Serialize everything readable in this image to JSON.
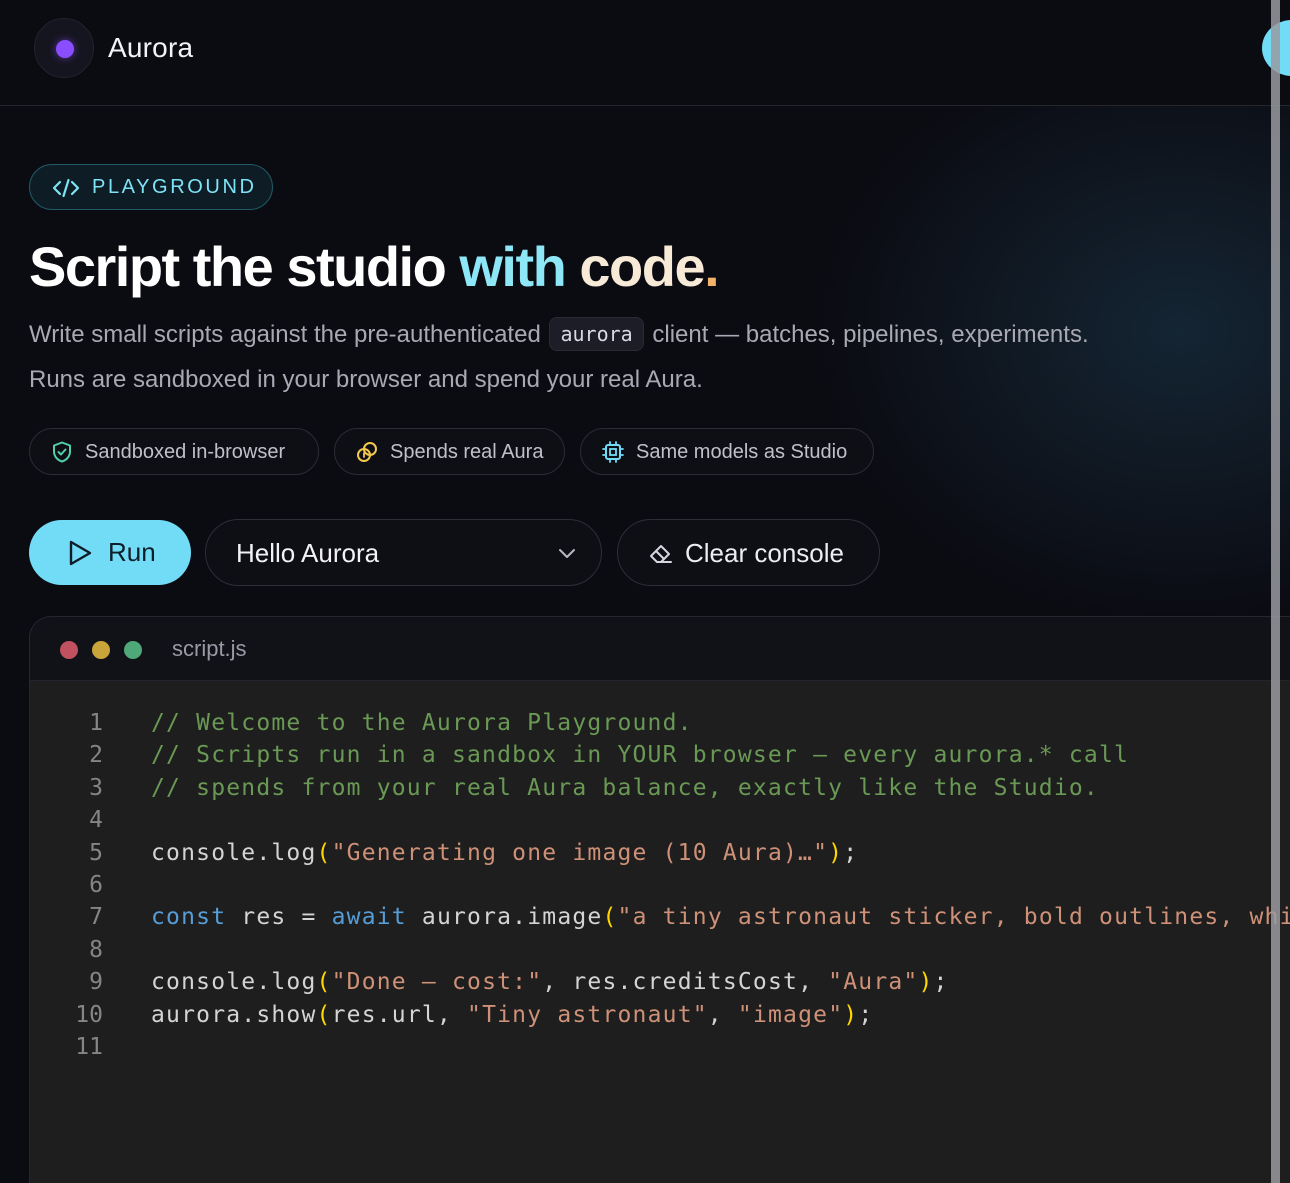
{
  "app": {
    "brand": "Aurora"
  },
  "hero": {
    "badge": "PLAYGROUND",
    "title_parts": [
      "Script the studio ",
      "with ",
      "code",
      "."
    ],
    "description": {
      "line1_before": "Write small scripts against the pre-authenticated ",
      "inline_code": "aurora",
      "line1_after": " client — batches, pipelines, experiments.",
      "line2": "Runs are sandboxed in your browser and spend your real Aura."
    }
  },
  "features": [
    {
      "icon": "shield-check-icon",
      "label": "Sandboxed in-browser"
    },
    {
      "icon": "coins-icon",
      "label": "Spends real Aura"
    },
    {
      "icon": "cpu-chip-icon",
      "label": "Same models as Studio"
    }
  ],
  "controls": {
    "run_label": "Run",
    "example_select": "Hello Aurora",
    "clear_label": "Clear console"
  },
  "editor": {
    "filename": "script.js",
    "lines": [
      {
        "n": "1",
        "tokens": [
          {
            "t": "// Welcome to the Aurora Playground.",
            "c": "comment"
          }
        ]
      },
      {
        "n": "2",
        "tokens": [
          {
            "t": "// Scripts run in a sandbox in YOUR browser — every aurora.* call",
            "c": "comment"
          }
        ]
      },
      {
        "n": "3",
        "tokens": [
          {
            "t": "// spends from your real Aura balance, exactly like the Studio.",
            "c": "comment"
          }
        ]
      },
      {
        "n": "4",
        "tokens": []
      },
      {
        "n": "5",
        "tokens": [
          {
            "t": "console.log",
            "c": "plain"
          },
          {
            "t": "(",
            "c": "paren"
          },
          {
            "t": "\"Generating one image (10 Aura)…\"",
            "c": "str"
          },
          {
            "t": ")",
            "c": "paren"
          },
          {
            "t": ";",
            "c": "plain"
          }
        ]
      },
      {
        "n": "6",
        "tokens": []
      },
      {
        "n": "7",
        "tokens": [
          {
            "t": "const",
            "c": "kw"
          },
          {
            "t": " res = ",
            "c": "plain"
          },
          {
            "t": "await",
            "c": "kw"
          },
          {
            "t": " aurora.image",
            "c": "plain"
          },
          {
            "t": "(",
            "c": "paren"
          },
          {
            "t": "\"a tiny astronaut sticker, bold outlines, white",
            "c": "str"
          }
        ]
      },
      {
        "n": "8",
        "tokens": []
      },
      {
        "n": "9",
        "tokens": [
          {
            "t": "console.log",
            "c": "plain"
          },
          {
            "t": "(",
            "c": "paren"
          },
          {
            "t": "\"Done — cost:\"",
            "c": "str"
          },
          {
            "t": ", res.creditsCost, ",
            "c": "plain"
          },
          {
            "t": "\"Aura\"",
            "c": "str"
          },
          {
            "t": ")",
            "c": "paren"
          },
          {
            "t": ";",
            "c": "plain"
          }
        ]
      },
      {
        "n": "10",
        "tokens": [
          {
            "t": "aurora.show",
            "c": "plain"
          },
          {
            "t": "(",
            "c": "paren"
          },
          {
            "t": "res.url, ",
            "c": "plain"
          },
          {
            "t": "\"Tiny astronaut\"",
            "c": "str"
          },
          {
            "t": ", ",
            "c": "plain"
          },
          {
            "t": "\"image\"",
            "c": "str"
          },
          {
            "t": ")",
            "c": "paren"
          },
          {
            "t": ";",
            "c": "plain"
          }
        ]
      },
      {
        "n": "11",
        "tokens": []
      }
    ]
  },
  "colors": {
    "accent": "#72dcf7",
    "brand_dot": "#8a4dff",
    "background": "#0b0b12"
  }
}
